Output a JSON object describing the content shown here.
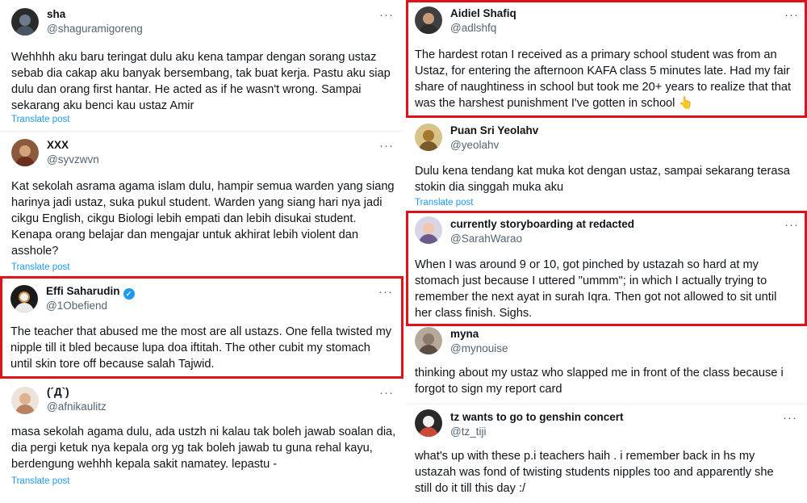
{
  "more_glyph": "···",
  "verified_glyph": "✓",
  "colors": {
    "highlight": "#e0121b",
    "link": "#1d9bf0",
    "muted": "#536471",
    "text": "#0f1419"
  },
  "left": [
    {
      "name": "sha",
      "handle": "@shaguramigoreng",
      "lines": [
        "Wehhhh aku baru teringat dulu aku kena tampar dengan sorang ustaz",
        "sebab dia cakap aku banyak bersembang, tak buat kerja. Pastu aku siap",
        "dulu dan orang first hantar. He acted as if he wasn't wrong. Sampai",
        "sekarang aku benci kau ustaz Amir"
      ],
      "translate": "Translate post"
    },
    {
      "name": "XXX",
      "handle": "@syvzwvn",
      "lines": [
        "Kat sekolah asrama agama islam dulu, hampir semua warden yang siang",
        "harinya jadi ustaz, suka pukul student. Warden yang siang hari nya jadi",
        "cikgu English, cikgu Biologi lebih empati dan lebih disukai student.",
        "Kenapa orang belajar dan mengajar untuk akhirat lebih violent dan",
        "asshole?"
      ],
      "translate": "Translate post"
    },
    {
      "name": "Effi Saharudin",
      "handle": "@1Obefiend",
      "lines": [
        "The teacher that abused me the most are all ustazs. One fella twisted my",
        "nipple till it bled because lupa doa iftitah. The other cubit my stomach",
        "until skin tore off because salah Tajwid."
      ]
    },
    {
      "name": "(´Д`)",
      "handle": "@afnikaulitz",
      "lines": [
        "masa sekolah agama dulu, ada ustzh ni kalau tak boleh jawab soalan dia,",
        "dia pergi ketuk nya kepala org yg tak boleh jawab tu guna rehal kayu,",
        "berdengung wehhh kepala sakit namatey. lepastu -"
      ],
      "translate": "Translate post"
    }
  ],
  "right": [
    {
      "name": "Aidiel Shafiq",
      "handle": "@adlshfq",
      "lines": [
        "The hardest rotan I received as a primary school student was from an",
        "Ustaz, for entering the afternoon KAFA class 5 minutes late. Had my fair",
        "share of naughtiness in school but took me 20+ years to realize that that",
        "was the harshest punishment I've gotten in school 👆"
      ]
    },
    {
      "name": "Puan Sri Yeolahv",
      "handle": "@yeolahv",
      "lines": [
        "Dulu kena tendang kat muka kot dengan ustaz, sampai sekarang terasa",
        "stokin dia singgah muka aku"
      ],
      "translate": "Translate post"
    },
    {
      "name": "currently storyboarding at redacted",
      "handle": "@SarahWarao",
      "lines": [
        "When I was around 9 or 10, got pinched by ustazah so hard at my",
        "stomach just because I uttered \"ummm\"; in which I actually trying to",
        "remember the next ayat in surah Iqra. Then got not allowed to sit until",
        "her class finish. Sighs."
      ]
    },
    {
      "name": "myna",
      "handle": "@mynouise",
      "lines": [
        "thinking about my ustaz who slapped me in front of the class because i",
        "forgot to sign my report card"
      ]
    },
    {
      "name": "tz wants to go to genshin concert",
      "handle": "@tz_tiji",
      "lines": [
        "what's up with these p.i teachers haih . i remember back in hs my",
        "ustazah was fond of twisting students nipples too and apparently she",
        "still do it till this day :/"
      ]
    }
  ]
}
